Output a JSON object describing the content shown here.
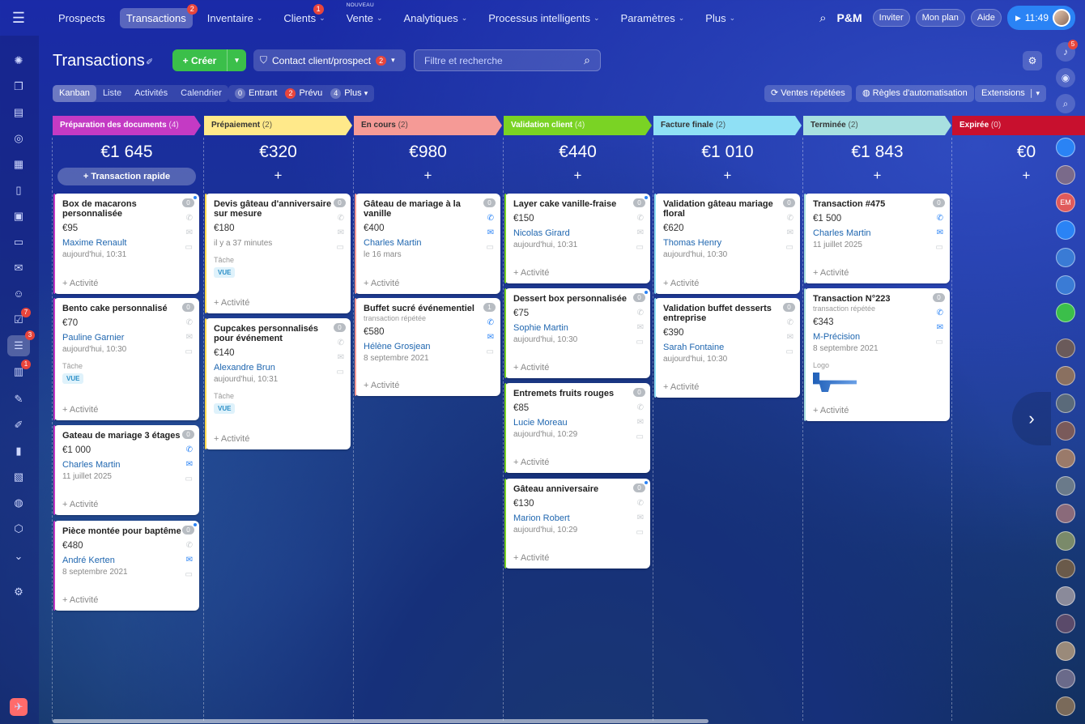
{
  "topnav": {
    "items": [
      {
        "label": "Prospects"
      },
      {
        "label": "Transactions",
        "badge": "2"
      },
      {
        "label": "Inventaire"
      },
      {
        "label": "Clients",
        "badge": "1"
      },
      {
        "label": "Vente",
        "tag": "NOUVEAU"
      },
      {
        "label": "Analytiques"
      },
      {
        "label": "Processus intelligents"
      },
      {
        "label": "Paramètres"
      },
      {
        "label": "Plus"
      }
    ],
    "brand": "P&M",
    "invite": "Inviter",
    "plan": "Mon plan",
    "help": "Aide",
    "time": "11:49"
  },
  "leftbar": {
    "badges": {
      "tasks": "7",
      "crm": "3",
      "calendar": "1"
    }
  },
  "rightbar": {
    "notif_badge": "5",
    "av_initials": "EM"
  },
  "page": {
    "title": "Transactions",
    "create_label": "Créer",
    "contact_label": "Contact client/prospect",
    "contact_count": "2",
    "search_placeholder": "Filtre et recherche"
  },
  "views": {
    "tabs": [
      "Kanban",
      "Liste",
      "Activités",
      "Calendrier"
    ]
  },
  "filters": {
    "incoming": {
      "count": "0",
      "label": "Entrant"
    },
    "planned": {
      "count": "2",
      "label": "Prévu"
    },
    "more": {
      "count": "4",
      "label": "Plus"
    }
  },
  "right_buttons": {
    "repeat": "Ventes répétées",
    "rules": "Règles d'automatisation",
    "extensions": "Extensions"
  },
  "quick_deal": "Transaction rapide",
  "add_activity": "+ Activité",
  "columns": [
    {
      "name": "Préparation des documents",
      "count": "(4)",
      "sum": "€1 645",
      "color": "#c43ac4",
      "text": "#fff"
    },
    {
      "name": "Prépaiement",
      "count": "(2)",
      "sum": "€320",
      "color": "#ffe98a",
      "text": "#333"
    },
    {
      "name": "En cours",
      "count": "(2)",
      "sum": "€980",
      "color": "#f59a96",
      "text": "#333"
    },
    {
      "name": "Validation client",
      "count": "(4)",
      "sum": "€440",
      "color": "#7ad324",
      "text": "#fff"
    },
    {
      "name": "Facture finale",
      "count": "(2)",
      "sum": "€1 010",
      "color": "#8fe0f5",
      "text": "#333"
    },
    {
      "name": "Terminée",
      "count": "(2)",
      "sum": "€1 843",
      "color": "#a8e0e0",
      "text": "#333"
    },
    {
      "name": "Expirée",
      "count": "(0)",
      "sum": "€0",
      "color": "#c8102e",
      "text": "#fff"
    }
  ],
  "cards": [
    {
      "title": "Box de macarons personnalisée",
      "price": "€95",
      "client": "Maxime Renault",
      "date": "aujourd'hui, 10:31",
      "num": "0"
    },
    {
      "title": "Bento cake personnalisé",
      "price": "€70",
      "client": "Pauline Garnier",
      "date": "aujourd'hui, 10:30",
      "label": "Tâche",
      "tag": "VUE",
      "num": "0"
    },
    {
      "title": "Gateau de mariage 3 étages",
      "price": "€1 000",
      "client": "Charles Martin",
      "date": "11 juillet 2025",
      "num": "0"
    },
    {
      "title": "Pièce montée pour baptême",
      "price": "€480",
      "client": "André Kerten",
      "date": "8 septembre 2021",
      "num": "0"
    },
    {
      "title": "Devis gâteau d'anniversaire sur mesure",
      "price": "€180",
      "date": "il y a 37 minutes",
      "label": "Tâche",
      "tag": "VUE",
      "num": "0"
    },
    {
      "title": "Cupcakes personnalisés pour événement",
      "price": "€140",
      "client": "Alexandre Brun",
      "date": "aujourd'hui, 10:31",
      "label": "Tâche",
      "tag": "VUE",
      "num": "0"
    },
    {
      "title": "Gâteau de mariage à la vanille",
      "price": "€400",
      "client": "Charles Martin",
      "date": "le 16 mars",
      "num": "0"
    },
    {
      "title": "Buffet sucré événementiel",
      "sub": "transaction répétée",
      "price": "€580",
      "client": "Hélène Grosjean",
      "date": "8 septembre 2021",
      "num": "1"
    },
    {
      "title": "Layer cake vanille-fraise",
      "price": "€150",
      "client": "Nicolas Girard",
      "date": "aujourd'hui, 10:31",
      "num": "0"
    },
    {
      "title": "Dessert box personnalisée",
      "price": "€75",
      "client": "Sophie Martin",
      "date": "aujourd'hui, 10:30",
      "num": "0"
    },
    {
      "title": "Entremets fruits rouges",
      "price": "€85",
      "client": "Lucie Moreau",
      "date": "aujourd'hui, 10:29",
      "num": "0"
    },
    {
      "title": "Gâteau anniversaire",
      "price": "€130",
      "client": "Marion Robert",
      "date": "aujourd'hui, 10:29",
      "num": "0"
    },
    {
      "title": "Validation gâteau mariage floral",
      "price": "€620",
      "client": "Thomas Henry",
      "date": "aujourd'hui, 10:30",
      "num": "0"
    },
    {
      "title": "Validation buffet desserts entreprise",
      "price": "€390",
      "client": "Sarah Fontaine",
      "date": "aujourd'hui, 10:30",
      "num": "0"
    },
    {
      "title": "Transaction #475",
      "price": "€1 500",
      "client": "Charles Martin",
      "date": "11 juillet 2025",
      "num": "0"
    },
    {
      "title": "Transaction N°223",
      "sub": "transaction répétée",
      "price": "€343",
      "client": "M-Précision",
      "date": "8 septembre 2021",
      "label": "Logo",
      "num": "0"
    }
  ]
}
